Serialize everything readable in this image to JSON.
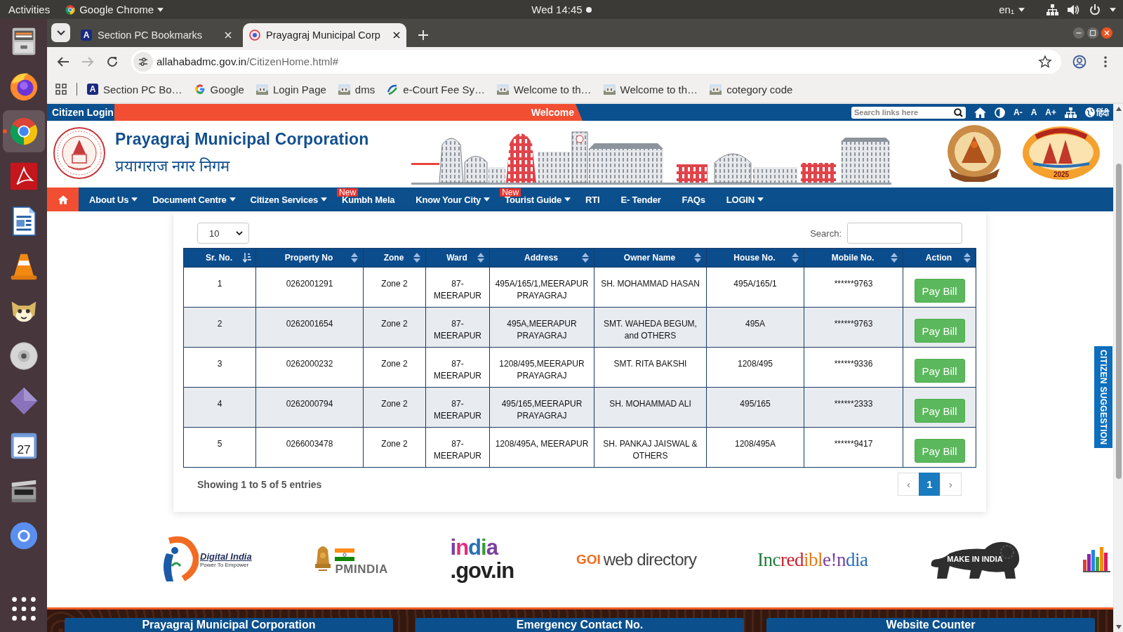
{
  "system_bar": {
    "activities": "Activities",
    "app_menu": "Google Chrome",
    "clock": "Wed 14:45",
    "keyboard": "en₁"
  },
  "dock": [
    {
      "kind": "files",
      "active": false
    },
    {
      "kind": "firefox",
      "active": false
    },
    {
      "kind": "chrome",
      "active": true
    },
    {
      "kind": "pdf",
      "active": false
    },
    {
      "kind": "writer",
      "active": false
    },
    {
      "kind": "vlc",
      "active": false
    },
    {
      "kind": "cat",
      "active": false
    },
    {
      "kind": "disc",
      "active": false
    },
    {
      "kind": "diamond",
      "active": false
    },
    {
      "kind": "calendar",
      "active": false,
      "text": "27"
    },
    {
      "kind": "scanner",
      "active": false
    },
    {
      "kind": "chromium",
      "active": false
    },
    {
      "kind": "apps",
      "active": false
    }
  ],
  "browser": {
    "tabs": [
      {
        "title": "Section PC Bookmarks",
        "kind": "letter",
        "letter": "A",
        "selected": false
      },
      {
        "title": "Prayagraj Municipal Corp",
        "kind": "seal",
        "selected": true
      }
    ],
    "nav_buttons": [
      {
        "kind": "back",
        "disabled": false
      },
      {
        "kind": "forward",
        "disabled": true
      },
      {
        "kind": "reload",
        "disabled": false
      }
    ],
    "address": {
      "domain": "allahabadmc.gov.in",
      "path": "/CitizenHome.html#"
    },
    "bookmarks": [
      {
        "label": "Section PC Bo…",
        "kind": "letter",
        "letter": "A"
      },
      {
        "label": "Google",
        "kind": "google"
      },
      {
        "label": "Login Page",
        "kind": "page"
      },
      {
        "label": "dms",
        "kind": "page"
      },
      {
        "label": "e-Court Fee Sy…",
        "kind": "ecourt"
      },
      {
        "label": "Welcome to th…",
        "kind": "page"
      },
      {
        "label": "Welcome to th…",
        "kind": "page"
      },
      {
        "label": "cotegory code",
        "kind": "page"
      }
    ]
  },
  "site": {
    "top_strip": {
      "login": "Citizen Login",
      "marquee": "Welcome",
      "search_placeholder": "Search links here",
      "text_size": [
        "A-",
        "A",
        "A+"
      ],
      "language": "हिंदी"
    },
    "header": {
      "title": "Prayagraj Municipal Corporation",
      "subtitle": "प्रयागराज नगर निगम",
      "festival_year": "2025"
    },
    "nav": [
      {
        "label": "About Us",
        "dropdown": true
      },
      {
        "label": "Document Centre",
        "dropdown": true
      },
      {
        "label": "Citizen Services",
        "dropdown": true
      },
      {
        "label": "Kumbh Mela",
        "dropdown": false,
        "badge": "New"
      },
      {
        "label": "Know Your City",
        "dropdown": true
      },
      {
        "label": "Tourist Guide",
        "dropdown": true,
        "badge": "New"
      },
      {
        "label": "RTI",
        "dropdown": false
      },
      {
        "label": "E- Tender",
        "dropdown": false
      },
      {
        "label": "FAQs",
        "dropdown": false
      },
      {
        "label": "LOGIN",
        "dropdown": true
      }
    ],
    "table": {
      "page_size": "10",
      "search_label": "Search:",
      "columns": [
        {
          "label": "Sr. No.",
          "sorted": true
        },
        {
          "label": "Property No",
          "sorted": false
        },
        {
          "label": "Zone",
          "sorted": false
        },
        {
          "label": "Ward",
          "sorted": false
        },
        {
          "label": "Address",
          "sorted": false
        },
        {
          "label": "Owner Name",
          "sorted": false
        },
        {
          "label": "House No.",
          "sorted": false
        },
        {
          "label": "Mobile No.",
          "sorted": false
        },
        {
          "label": "Action",
          "sorted": false
        }
      ],
      "rows": [
        {
          "cells": [
            "1",
            "0262001291",
            "Zone 2",
            "87-MEERAPUR",
            "495A/165/1,MEERAPUR PRAYAGRAJ",
            "SH. MOHAMMAD HASAN",
            "495A/165/1",
            "******9763"
          ],
          "action": "Pay Bill"
        },
        {
          "cells": [
            "2",
            "0262001654",
            "Zone 2",
            "87-MEERAPUR",
            "495A,MEERAPUR PRAYAGRAJ",
            "SMT. WAHEDA BEGUM, and OTHERS",
            "495A",
            "******9763"
          ],
          "action": "Pay Bill"
        },
        {
          "cells": [
            "3",
            "0262000232",
            "Zone 2",
            "87-MEERAPUR",
            "1208/495,MEERAPUR PRAYAGRAJ",
            "SMT. RITA BAKSHI",
            "1208/495",
            "******9336"
          ],
          "action": "Pay Bill"
        },
        {
          "cells": [
            "4",
            "0262000794",
            "Zone 2",
            "87-MEERAPUR",
            "495/165,MEERAPUR PRAYAGRAJ",
            "SH. MOHAMMAD ALI",
            "495/165",
            "******2333"
          ],
          "action": "Pay Bill"
        },
        {
          "cells": [
            "5",
            "0266003478",
            "Zone 2",
            "87-MEERAPUR",
            "1208/495A, MEERAPUR",
            "SH. PANKAJ JAISWAL & OTHERS",
            "1208/495A",
            "******9417"
          ],
          "action": "Pay Bill"
        }
      ],
      "info": "Showing 1 to 5 of 5 entries",
      "pagination": {
        "previous": "‹",
        "pages": [
          {
            "label": "1",
            "selected": true
          }
        ],
        "next": "›"
      }
    },
    "suggestion_tab": "CITIZEN SUGGESTION",
    "partner_logos": [
      {
        "kind": "digital_india",
        "texts": [
          "Digital India",
          "Power To Empower"
        ]
      },
      {
        "kind": "pmindia",
        "texts": [
          "PMINDIA"
        ]
      },
      {
        "kind": "india_gov",
        "texts": [
          "india",
          ".gov.in"
        ]
      },
      {
        "kind": "goi_directory",
        "texts": [
          "GOI",
          "web directory"
        ]
      },
      {
        "kind": "incredible_india",
        "texts": [
          "Incredible!ndia"
        ]
      },
      {
        "kind": "make_in_india",
        "texts": [
          "MAKE IN INDIA"
        ]
      },
      {
        "kind": "bar_mark"
      }
    ],
    "footer_panels": [
      "Prayagraj Municipal Corporation",
      "Emergency Contact No.",
      "Website Counter"
    ]
  }
}
